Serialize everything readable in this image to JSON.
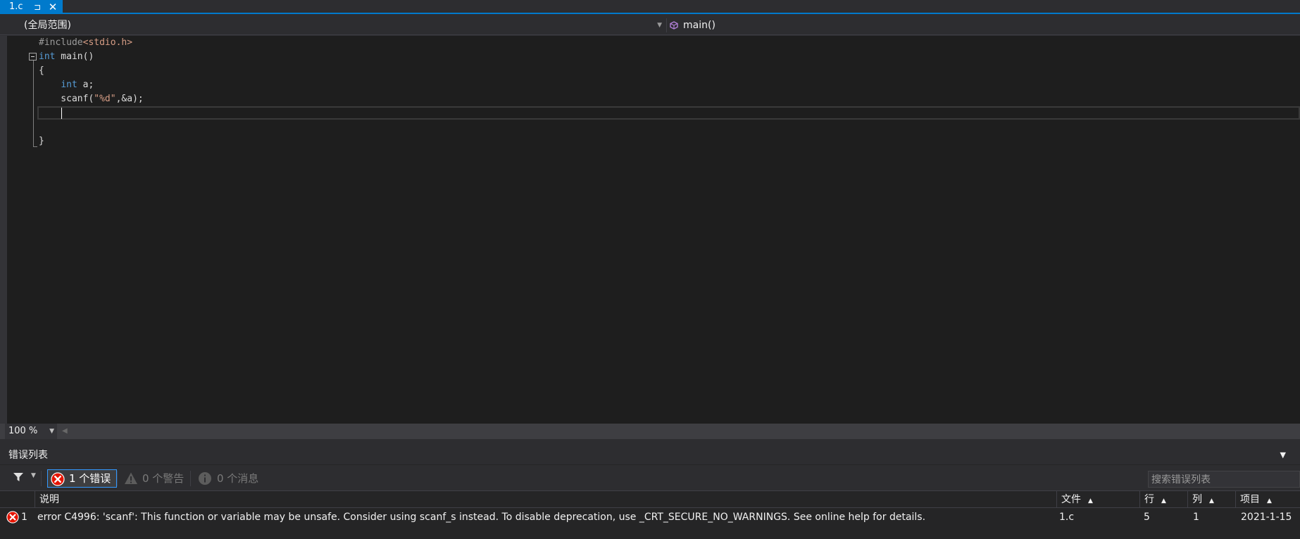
{
  "tab": {
    "name": "1.c",
    "pin_glyph": "⊐",
    "close_glyph": "✕"
  },
  "navbar": {
    "scope": "(全局范围)",
    "member": "main()"
  },
  "editor": {
    "lines": [
      [
        {
          "t": "#include",
          "c": "tok-pre"
        },
        {
          "t": "<stdio.h>",
          "c": "tok-inc"
        }
      ],
      [
        {
          "t": "int",
          "c": "tok-kw"
        },
        {
          "t": " main()",
          "c": "tok-fn"
        }
      ],
      [
        {
          "t": "{",
          "c": "tok-fn"
        }
      ],
      [
        {
          "t": "    ",
          "c": ""
        },
        {
          "t": "int",
          "c": "tok-kw"
        },
        {
          "t": " a;",
          "c": "tok-fn"
        }
      ],
      [
        {
          "t": "    scanf(",
          "c": "tok-fn"
        },
        {
          "t": "\"%d\"",
          "c": "tok-str"
        },
        {
          "t": ",&a);",
          "c": "tok-fn"
        }
      ],
      [
        {
          "t": "",
          "c": ""
        }
      ],
      [
        {
          "t": "",
          "c": ""
        }
      ],
      [
        {
          "t": "}",
          "c": "tok-fn"
        }
      ]
    ]
  },
  "zoom": {
    "value": "100 %"
  },
  "error_list": {
    "title": "错误列表",
    "errors_button": "1 个错误",
    "warnings_button": "0 个警告",
    "messages_button": "0 个消息",
    "search_placeholder": "搜索错误列表",
    "columns": {
      "description": "说明",
      "file": "文件",
      "line": "行",
      "column": "列",
      "project": "项目"
    },
    "rows": [
      {
        "index": "1",
        "description": "error C4996: 'scanf': This function or variable may be unsafe. Consider using scanf_s instead. To disable deprecation, use _CRT_SECURE_NO_WARNINGS. See online help for details.",
        "file": "1.c",
        "line": "5",
        "column": "1",
        "project": "2021-1-15"
      }
    ]
  },
  "colors": {
    "accent": "#007acc",
    "editor_bg": "#1e1e1e",
    "keyword": "#569cd6",
    "error_red": "#e51400"
  }
}
